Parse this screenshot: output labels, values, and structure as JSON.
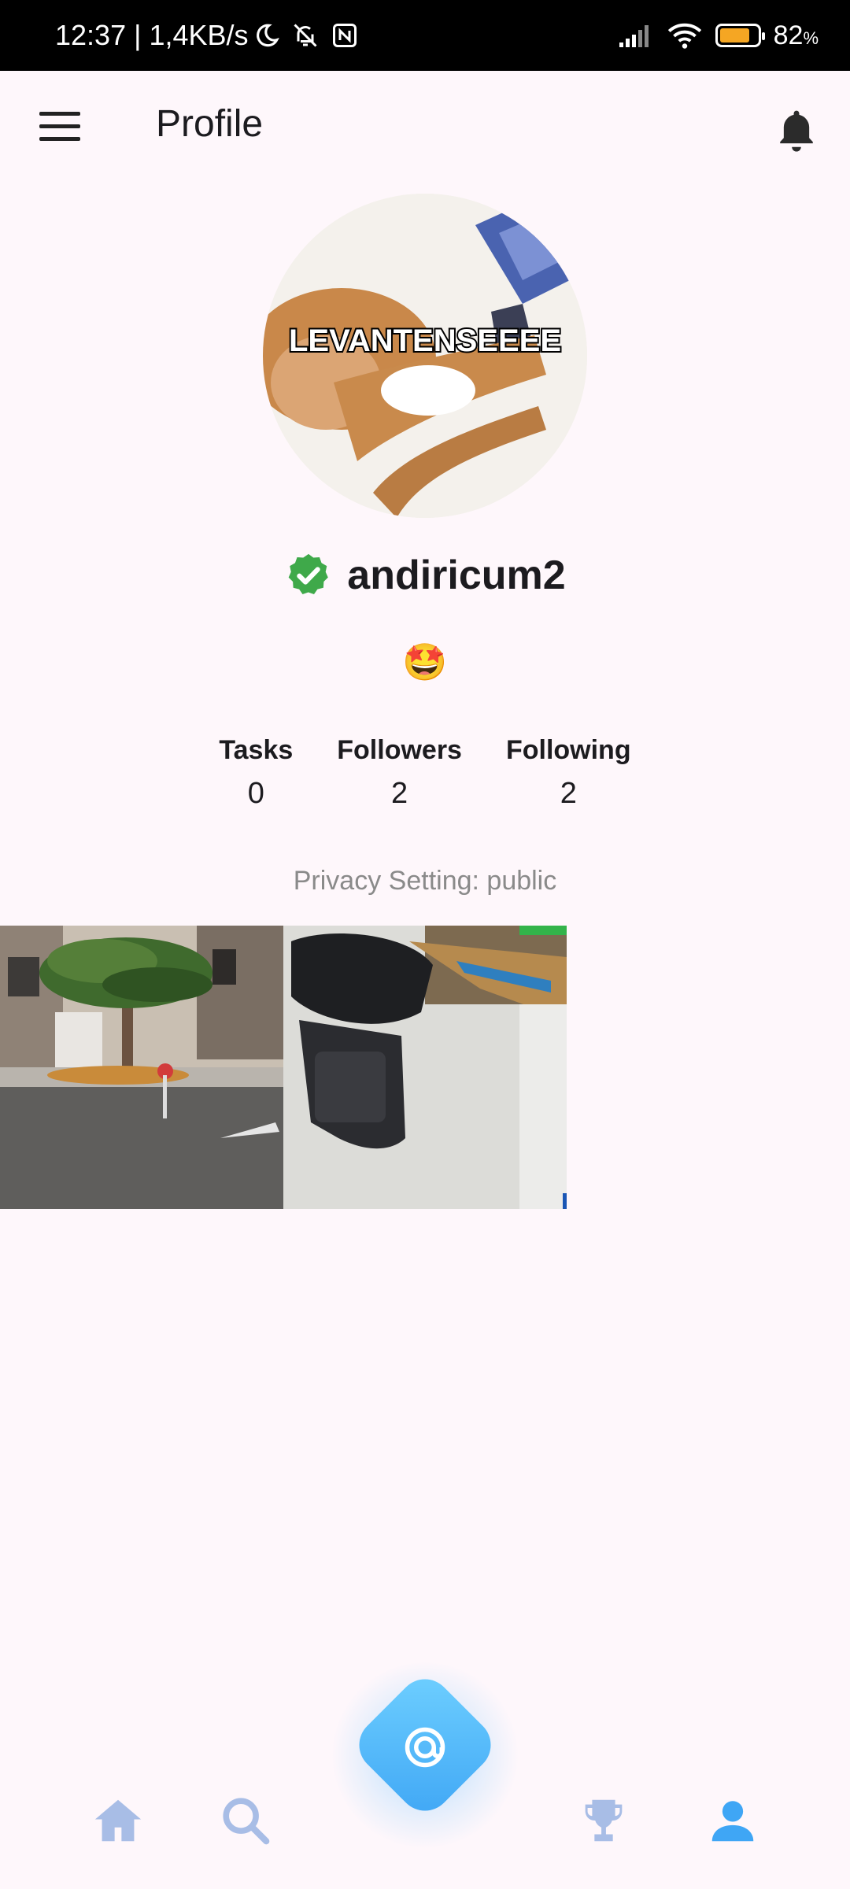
{
  "status_bar": {
    "time": "12:37",
    "speed": "| 1,4KB/s",
    "battery_text": "82",
    "battery_percent_sign": "%",
    "battery_level": 0.82,
    "icons": [
      "moon-icon",
      "bell-off-icon",
      "nfc-icon",
      "signal-icon",
      "wifi-icon",
      "battery-icon"
    ]
  },
  "app_bar": {
    "title": "Profile",
    "menu_icon": "menu-icon",
    "notifications_icon": "bell-icon"
  },
  "profile": {
    "avatar_caption": "LEVANTENSEEEE",
    "username": "andiricum2",
    "verified_icon": "verified-badge-icon",
    "bio_emoji": "🤩",
    "stats": [
      {
        "label": "Tasks",
        "value": "0"
      },
      {
        "label": "Followers",
        "value": "2"
      },
      {
        "label": "Following",
        "value": "2"
      }
    ],
    "privacy_text": "Privacy Setting: public"
  },
  "posts": [
    {
      "name": "post-photo-street-palm"
    },
    {
      "name": "post-photo-calculator"
    }
  ],
  "bottom_nav": {
    "items": [
      "home-icon",
      "search-icon",
      "capture-icon",
      "trophy-icon",
      "profile-icon"
    ],
    "active": "profile-icon"
  },
  "colors": {
    "background": "#fef7fb",
    "accent": "#3fa6f5",
    "nav_inactive": "#a8bde6",
    "verified": "#3fa94a"
  }
}
